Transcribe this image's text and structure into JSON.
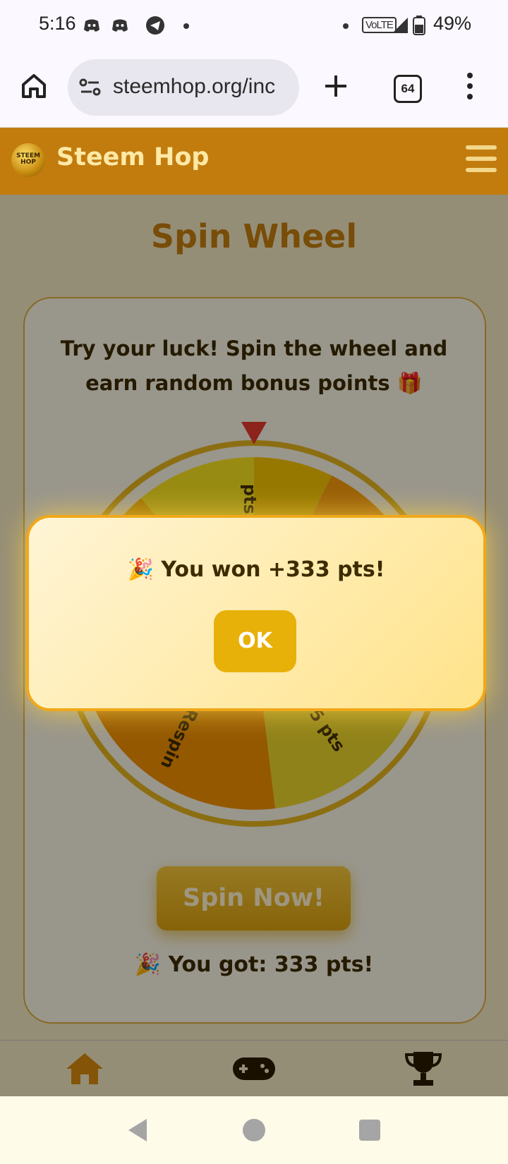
{
  "status_bar": {
    "time": "5:16",
    "network": "VoLTE",
    "battery": "49%"
  },
  "browser": {
    "url": "steemhop.org/inc",
    "tab_count": "64"
  },
  "app": {
    "title": "Steem Hop",
    "logo_text": "STEEM HOP"
  },
  "page": {
    "title": "Spin Wheel",
    "intro": "Try your luck! Spin the wheel and earn random bonus points 🎁",
    "wheel_segments": [
      {
        "label": "pts"
      },
      {
        "label": "55 pts"
      },
      {
        "label": "Respin"
      }
    ],
    "spin_button": "Spin Now!",
    "result": "🎉 You got: 333 pts!"
  },
  "dialog": {
    "message": "🎉 You won +333 pts!",
    "ok_button": "OK"
  },
  "bottom_nav": [
    {
      "icon": "home-icon"
    },
    {
      "icon": "gamepad-icon"
    },
    {
      "icon": "trophy-icon"
    }
  ],
  "colors": {
    "brand": "#c27c0e",
    "accent": "#e8b10a"
  }
}
